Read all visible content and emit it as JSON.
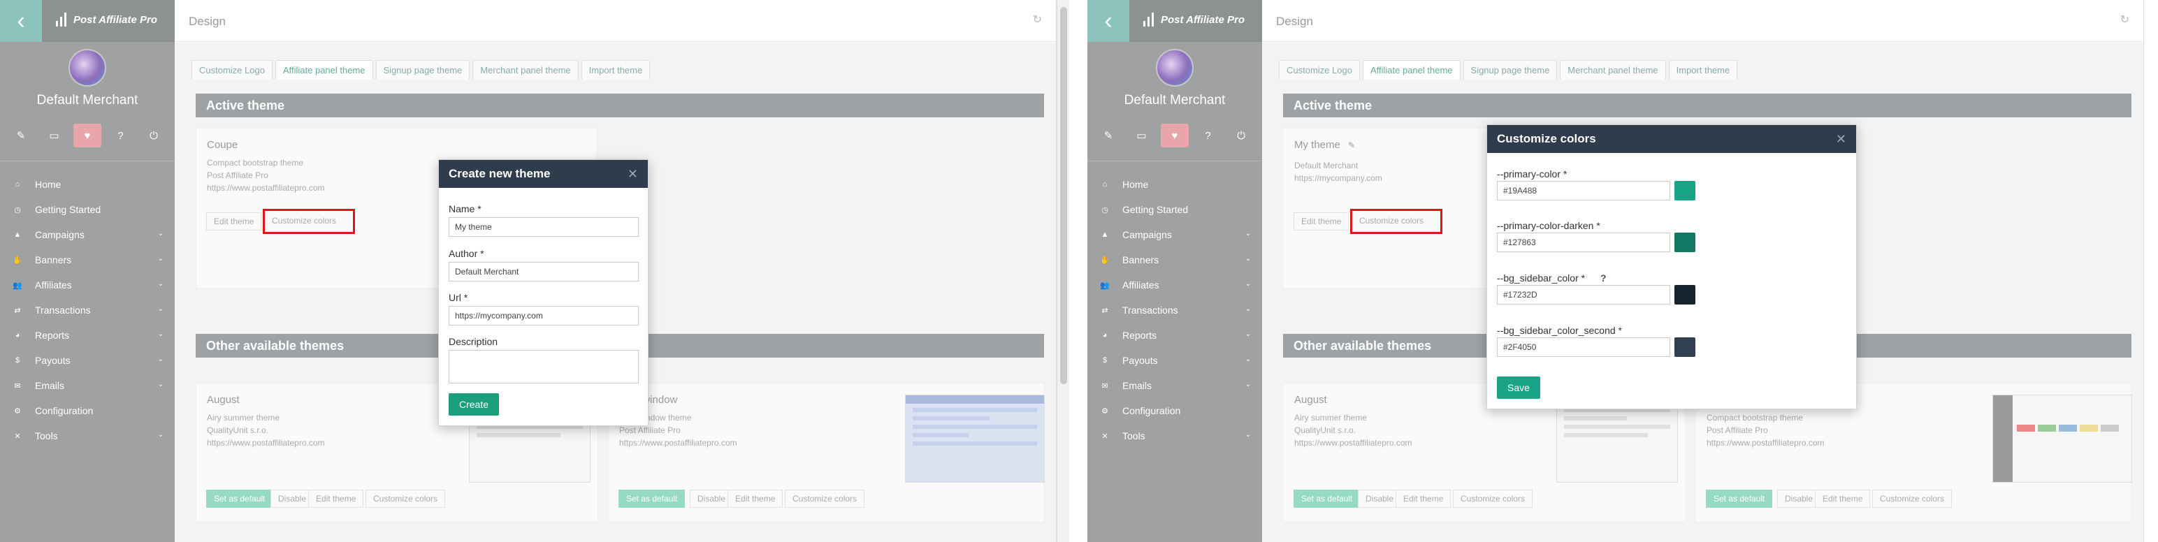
{
  "app": {
    "brand": "Post Affiliate Pro",
    "page_title": "Design",
    "merchant": "Default Merchant"
  },
  "sidebar": {
    "items": [
      {
        "label": "Home",
        "icon": "home-icon",
        "glyph": "⌂",
        "chevron": false
      },
      {
        "label": "Getting Started",
        "icon": "clock-icon",
        "glyph": "◷",
        "chevron": false
      },
      {
        "label": "Campaigns",
        "icon": "chart-icon",
        "glyph": "▲",
        "chevron": true
      },
      {
        "label": "Banners",
        "icon": "hand-icon",
        "glyph": "✋",
        "chevron": true
      },
      {
        "label": "Affiliates",
        "icon": "users-icon",
        "glyph": "👥",
        "chevron": true
      },
      {
        "label": "Transactions",
        "icon": "exchange-icon",
        "glyph": "⇄",
        "chevron": true
      },
      {
        "label": "Reports",
        "icon": "pie-icon",
        "glyph": "◕",
        "chevron": true
      },
      {
        "label": "Payouts",
        "icon": "money-icon",
        "glyph": "$",
        "chevron": true
      },
      {
        "label": "Emails",
        "icon": "envelope-icon",
        "glyph": "✉",
        "chevron": true
      },
      {
        "label": "Configuration",
        "icon": "gear-icon",
        "glyph": "⚙",
        "chevron": false
      },
      {
        "label": "Tools",
        "icon": "tools-icon",
        "glyph": "✕",
        "chevron": true
      }
    ]
  },
  "tabs": [
    "Customize Logo",
    "Affiliate panel theme",
    "Signup page theme",
    "Merchant panel theme",
    "Import theme"
  ],
  "sections": {
    "active": "Active theme",
    "other": "Other available themes"
  },
  "left": {
    "active_theme": {
      "name": "Coupe",
      "lines": [
        "Compact bootstrap theme",
        "Post Affiliate Pro",
        "https://www.postaffiliatepro.com"
      ]
    },
    "themes": [
      {
        "name": "August",
        "lines": [
          "Airy summer theme",
          "QualityUnit s.r.o.",
          "https://www.postaffiliatepro.com"
        ]
      },
      {
        "name": "...pe window",
        "lines": [
          "...pe window theme",
          "Post Affiliate Pro",
          "https://www.postaffiliatepro.com"
        ]
      }
    ],
    "modal": {
      "title": "Create new theme",
      "name_label": "Name *",
      "name_value": "My theme",
      "author_label": "Author *",
      "author_value": "Default Merchant",
      "url_label": "Url *",
      "url_value": "https://mycompany.com",
      "desc_label": "Description",
      "create_label": "Create"
    }
  },
  "right": {
    "active_theme": {
      "name": "My theme",
      "lines": [
        "Default Merchant",
        "https://mycompany.com"
      ]
    },
    "themes": [
      {
        "name": "August",
        "lines": [
          "Airy summer theme",
          "QualityUnit s.r.o.",
          "https://www.postaffiliatepro.com"
        ]
      },
      {
        "name": "",
        "lines": [
          "Compact bootstrap theme",
          "Post Affiliate Pro",
          "https://www.postaffiliatepro.com"
        ]
      }
    ],
    "modal": {
      "title": "Customize colors",
      "fields": [
        {
          "label": "--primary-color *",
          "value": "#19A488",
          "color": "#19A488",
          "help": ""
        },
        {
          "label": "--primary-color-darken *",
          "value": "#127863",
          "color": "#127863",
          "help": ""
        },
        {
          "label": "--bg_sidebar_color *",
          "value": "#17232D",
          "color": "#17232D",
          "help": "?"
        },
        {
          "label": "--bg_sidebar_color_second *",
          "value": "#2F4050",
          "color": "#2F4050",
          "help": ""
        }
      ],
      "save_label": "Save"
    }
  },
  "buttons": {
    "edit_theme": "Edit theme",
    "customize_colors": "Customize colors",
    "set_default": "Set as default",
    "disable": "Disable"
  },
  "colors": {
    "highlight": "#e0141b",
    "modal_header": "#2e3c4b",
    "primary_button": "#1b9e7c",
    "sidebar": "#9fa1a3"
  }
}
